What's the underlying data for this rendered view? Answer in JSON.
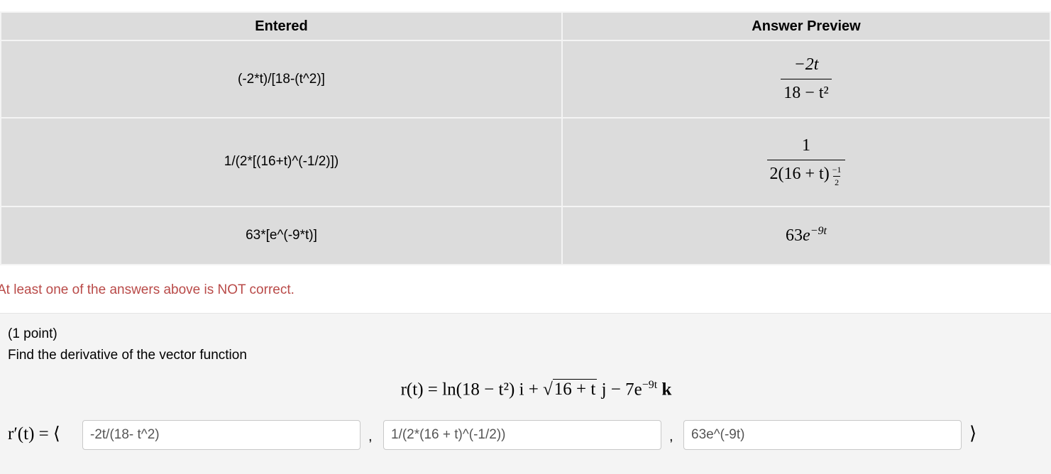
{
  "results_table": {
    "headers": [
      "Entered",
      "Answer Preview"
    ],
    "rows": [
      {
        "entered": "(-2*t)/[18-(t^2)]",
        "preview": {
          "num": "−2t",
          "den": "18 − t²"
        }
      },
      {
        "entered": "1/(2*[(16+t)^(-1/2)])",
        "preview": {
          "num": "1",
          "den_base": "2(16 + t)",
          "exp_num": "−1",
          "exp_den": "2"
        }
      },
      {
        "entered": "63*[e^(-9*t)]",
        "preview": {
          "coef": "63",
          "base": "e",
          "exp": "−9t"
        }
      }
    ]
  },
  "feedback": {
    "message": "At least one of the answers above is NOT correct."
  },
  "problem": {
    "points": "(1 point)",
    "prompt": "Find the derivative of the vector function",
    "formula": {
      "lhs": "r(t) = ln(18 − t²) i + ",
      "sqrt": "16 + t",
      "after_sqrt": " j − 7e",
      "exp": "−9t",
      "k": " k"
    },
    "answer_label": "r′(t) = ⟨",
    "answers": [
      "-2t/(18- t^2)",
      "1/(2*(16 + t)^(-1/2))",
      "63e^(-9t)"
    ],
    "separator": ",",
    "closing": "⟩"
  }
}
